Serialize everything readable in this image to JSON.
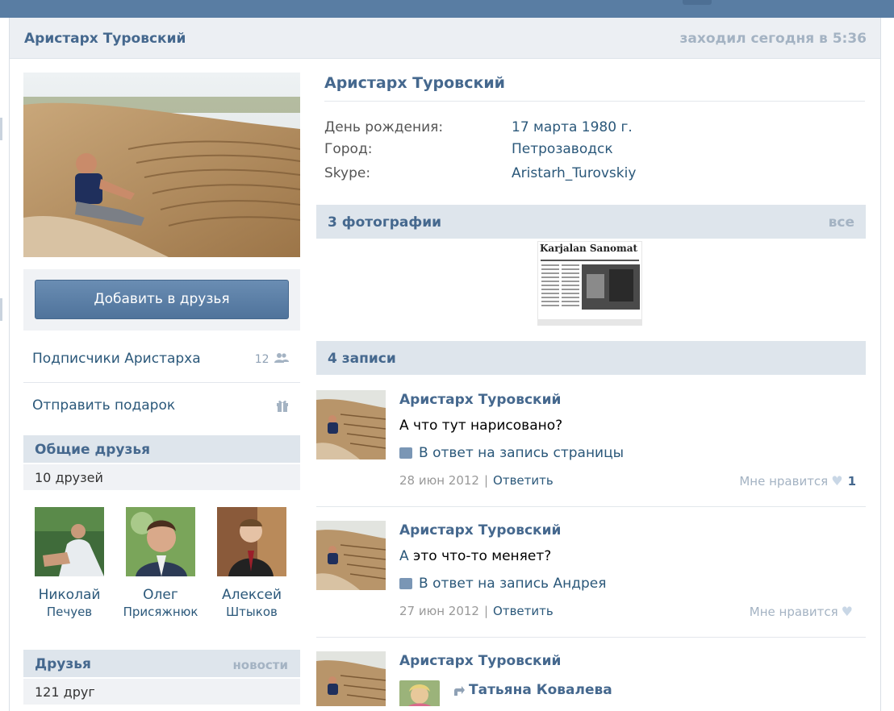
{
  "header": {
    "name": "Аристарх Туровский",
    "last_seen": "заходил сегодня в 5:36"
  },
  "left": {
    "add_friend_button": "Добавить в друзья",
    "followers": {
      "label": "Подписчики Аристарха",
      "count": "12"
    },
    "gift": {
      "label": "Отправить подарок"
    },
    "mutual": {
      "title": "Общие друзья",
      "count": "10 друзей",
      "friends": [
        {
          "first": "Николай",
          "last": "Печуев"
        },
        {
          "first": "Олег",
          "last": "Присяжнюк"
        },
        {
          "first": "Алексей",
          "last": "Штыков"
        }
      ]
    },
    "friends": {
      "title": "Друзья",
      "news_link": "новости",
      "count": "121 друг"
    }
  },
  "profile": {
    "name": "Аристарх Туровский",
    "info": [
      {
        "label": "День рождения:",
        "value": "17 марта 1980 г."
      },
      {
        "label": "Город:",
        "value": "Петрозаводск"
      },
      {
        "label": "Skype:",
        "value": "Aristarh_Turovskiy"
      }
    ]
  },
  "photos": {
    "title": "3 фотографии",
    "all_link": "все",
    "newspaper_masthead": "Karjalan Sanomat"
  },
  "wall": {
    "title": "4 записи",
    "posts": [
      {
        "author": "Аристарх Туровский",
        "text": "А что тут нарисовано?",
        "reply_prefix": "В ответ на",
        "reply_target": "запись страницы",
        "date": "28 июн 2012",
        "reply_link": "Ответить",
        "like_label": "Мне нравится",
        "likes": "1"
      },
      {
        "author": "Аристарх Туровский",
        "text_link": "А",
        "text": "это что-то меняет?",
        "reply_prefix": "В ответ на",
        "reply_target": "запись Андрея",
        "date": "27 июн 2012",
        "reply_link": "Ответить",
        "like_label": "Мне нравится"
      },
      {
        "author": "Аристарх Туровский",
        "repost_author": "Татьяна Ковалева"
      }
    ]
  }
}
